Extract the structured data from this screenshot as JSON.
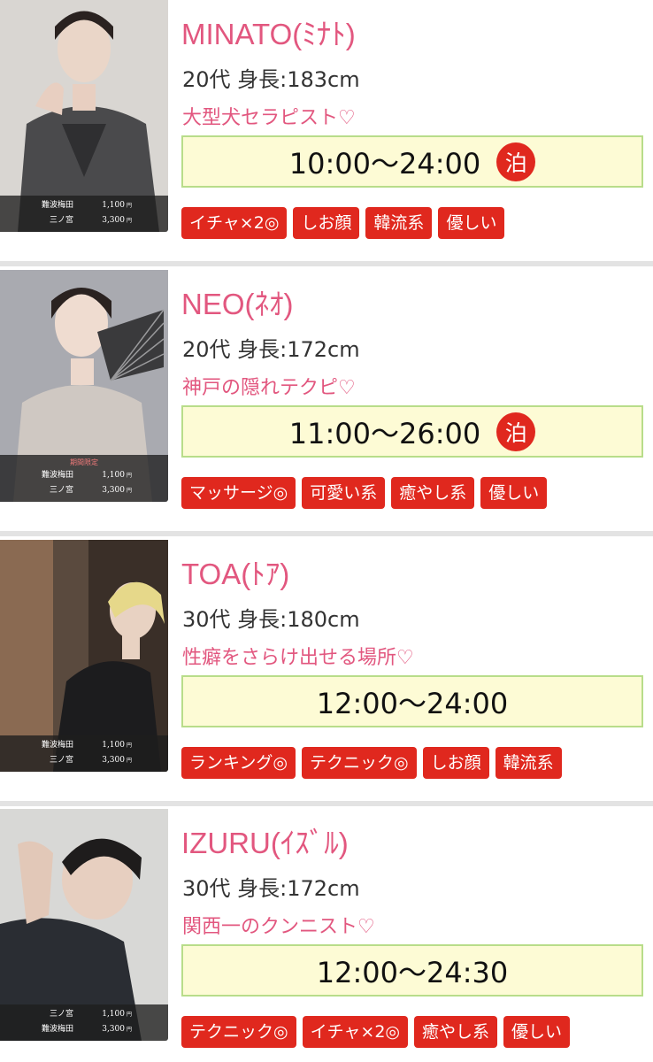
{
  "therapists": [
    {
      "name": "MINATO(ﾐﾅﾄ)",
      "stats": "20代 身長:183cm",
      "catchphrase": "大型犬セラピスト♡",
      "hours": "10:00〜24:00",
      "stay": "泊",
      "price_note": "",
      "prices": [
        {
          "area": "難波梅田",
          "price": "1,100",
          "unit": "円"
        },
        {
          "area": "三ノ宮",
          "price": "3,300",
          "unit": "円"
        }
      ],
      "tags": [
        "イチャ×2◎",
        "しお顔",
        "韓流系",
        "優しい"
      ]
    },
    {
      "name": "NEO(ﾈｵ)",
      "stats": "20代 身長:172cm",
      "catchphrase": "神戸の隠れテクピ♡",
      "hours": "11:00〜26:00",
      "stay": "泊",
      "price_note": "期間限定",
      "prices": [
        {
          "area": "難波梅田",
          "price": "1,100",
          "unit": "円"
        },
        {
          "area": "三ノ宮",
          "price": "3,300",
          "unit": "円"
        }
      ],
      "tags": [
        "マッサージ◎",
        "可愛い系",
        "癒やし系",
        "優しい"
      ]
    },
    {
      "name": "TOA(ﾄｱ)",
      "stats": "30代 身長:180cm",
      "catchphrase": "性癖をさらけ出せる場所♡",
      "hours": "12:00〜24:00",
      "stay": "",
      "price_note": "",
      "prices": [
        {
          "area": "難波梅田",
          "price": "1,100",
          "unit": "円"
        },
        {
          "area": "三ノ宮",
          "price": "3,300",
          "unit": "円"
        }
      ],
      "tags": [
        "ランキング◎",
        "テクニック◎",
        "しお顔",
        "韓流系"
      ]
    },
    {
      "name": "IZURU(ｲｽﾞﾙ)",
      "stats": "30代 身長:172cm",
      "catchphrase": "関西一のクンニスト♡",
      "hours": "12:00〜24:30",
      "stay": "",
      "price_note": "",
      "prices": [
        {
          "area": "三ノ宮",
          "price": "1,100",
          "unit": "円"
        },
        {
          "area": "難波梅田",
          "price": "3,300",
          "unit": "円"
        }
      ],
      "tags": [
        "テクニック◎",
        "イチャ×2◎",
        "癒やし系",
        "優しい"
      ]
    }
  ],
  "colors": {
    "name_pink": "#e2577f",
    "tag_red": "#e0281e",
    "hours_bg": "#fdfbd5",
    "hours_border": "#b8dd8a"
  }
}
